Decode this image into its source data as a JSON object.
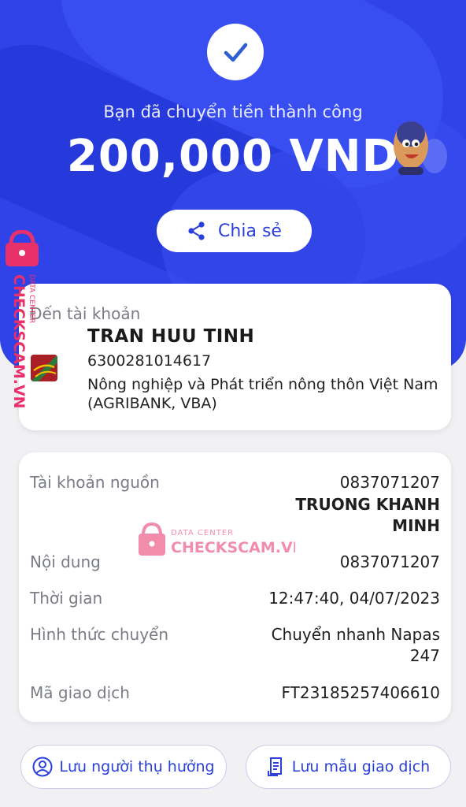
{
  "hero": {
    "success_text": "Bạn đã chuyển tiền thành công",
    "amount": "200,000 VND",
    "share_label": "Chia sẻ"
  },
  "recipient": {
    "to_label": "Đến tài khoản",
    "name": "TRAN HUU TINH",
    "account": "6300281014617",
    "bank": "Nông nghiệp và Phát triển nông thôn Việt Nam (AGRIBANK, VBA)"
  },
  "details": {
    "source_label": "Tài khoản nguồn",
    "source_account": "0837071207",
    "source_name_line1": "TRUONG KHANH",
    "source_name_line2": "MINH",
    "content_label": "Nội dung",
    "content_value": "0837071207",
    "time_label": "Thời gian",
    "time_value": "12:47:40, 04/07/2023",
    "method_label": "Hình thức chuyển",
    "method_value_line1": "Chuyển nhanh Napas",
    "method_value_line2": "247",
    "txn_label": "Mã giao dịch",
    "txn_value": "FT23185257406610"
  },
  "watermark": {
    "side_small": "DATA CENTER",
    "side_big": "CHECKSCAM.VN",
    "center_small": "DATA CENTER",
    "center_big": "CHECKSCAM.VN"
  },
  "actions": {
    "save_beneficiary": "Lưu người thụ hưởng",
    "save_template": "Lưu mẫu giao dịch"
  },
  "colors": {
    "primary": "#2f43e8",
    "watermark": "#e8306a"
  }
}
